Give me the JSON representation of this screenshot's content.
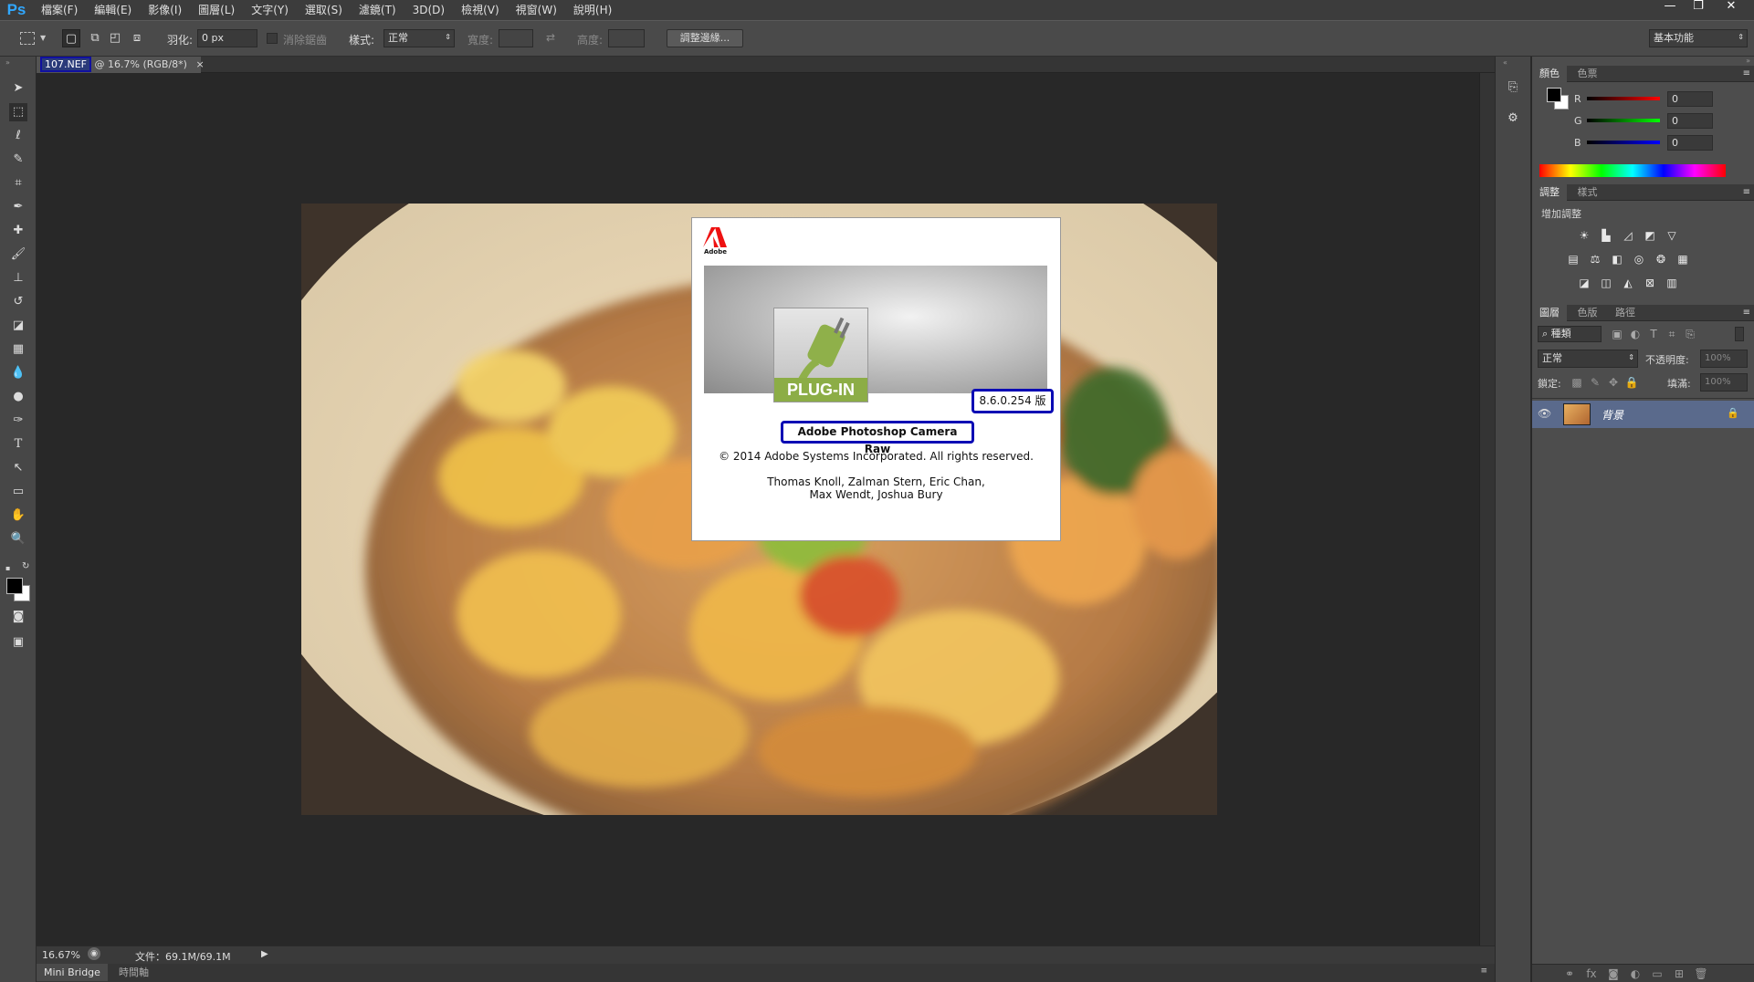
{
  "app": {
    "logo": "Ps"
  },
  "menu": [
    "檔案(F)",
    "編輯(E)",
    "影像(I)",
    "圖層(L)",
    "文字(Y)",
    "選取(S)",
    "濾鏡(T)",
    "3D(D)",
    "檢視(V)",
    "視窗(W)",
    "說明(H)"
  ],
  "window_controls": {
    "minimize": "—",
    "restore": "❐",
    "close": "✕"
  },
  "options": {
    "feather_label": "羽化:",
    "feather_value": "0 px",
    "antialias_label": "消除鋸齒",
    "style_label": "樣式:",
    "style_value": "正常",
    "width_label": "寬度:",
    "height_label": "高度:",
    "refine_edge_button": "調整邊緣...",
    "workspace": "基本功能"
  },
  "document": {
    "name": "107.NEF",
    "info": "@ 16.7% (RGB/8*)",
    "close": "×"
  },
  "dialog": {
    "brand": "Adobe",
    "badge": "PLUG-IN",
    "version": "8.6.0.254 版",
    "product": "Adobe Photoshop Camera Raw",
    "copyright": "© 2014 Adobe Systems Incorporated. All rights reserved.",
    "credits_line1": "Thomas Knoll, Zalman Stern, Eric Chan,",
    "credits_line2": "Max Wendt, Joshua Bury"
  },
  "status": {
    "zoom": "16.67%",
    "doc_size": "文件：69.1M/69.1M"
  },
  "bottom_tabs": [
    "Mini Bridge",
    "時間軸"
  ],
  "color_panel": {
    "tabs": [
      "顏色",
      "色票"
    ],
    "channels": [
      {
        "label": "R",
        "value": "0",
        "color": "#e02020"
      },
      {
        "label": "G",
        "value": "0",
        "color": "#20c020"
      },
      {
        "label": "B",
        "value": "0",
        "color": "#2040e0"
      }
    ]
  },
  "adjust_panel": {
    "tabs": [
      "調整",
      "樣式"
    ],
    "title": "增加調整"
  },
  "layers_panel": {
    "tabs": [
      "圖層",
      "色版",
      "路徑"
    ],
    "kind_filter": "種類",
    "blend_mode": "正常",
    "opacity_label": "不透明度:",
    "opacity_value": "100%",
    "lock_label": "鎖定:",
    "fill_label": "填滿:",
    "fill_value": "100%",
    "layer_name": "背景"
  },
  "accent_colors": {
    "selection": "#1010a0",
    "layer_selected": "#5a6a8c"
  }
}
